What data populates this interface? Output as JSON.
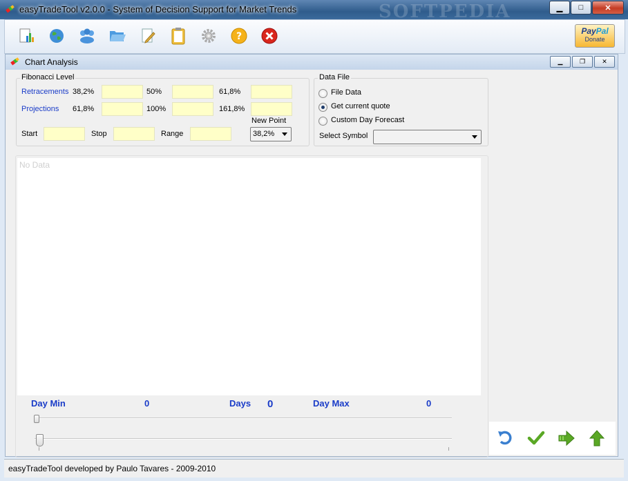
{
  "window": {
    "title": "easyTradeTool v2.0.0 - System of Decision Support for Market Trends",
    "watermark": "SOFTPEDIA"
  },
  "toolbar": {
    "icons": [
      "report-chart-icon",
      "globe-icon",
      "users-group-icon",
      "open-folder-icon",
      "edit-document-icon",
      "clipboard-icon",
      "settings-gear-icon",
      "help-icon",
      "exit-icon"
    ],
    "paypal_brand_1": "Pay",
    "paypal_brand_2": "Pal",
    "paypal_label": "Donate"
  },
  "child": {
    "title": "Chart Analysis"
  },
  "fibonacci": {
    "group_label": "Fibonacci Level",
    "retracements_label": "Retracements",
    "retracement_levels": [
      "38,2%",
      "50%",
      "61,8%"
    ],
    "projections_label": "Projections",
    "projection_levels": [
      "61,8%",
      "100%",
      "161,8%"
    ],
    "start_label": "Start",
    "stop_label": "Stop",
    "range_label": "Range",
    "new_point_label": "New Point",
    "new_point_value": "38,2%"
  },
  "data_file": {
    "group_label": "Data File",
    "options": [
      "File Data",
      "Get current quote",
      "Custom Day Forecast"
    ],
    "selected_option": "Get current quote",
    "select_symbol_label": "Select Symbol",
    "symbol_value": ""
  },
  "chart": {
    "placeholder": "No Data"
  },
  "stats": {
    "day_min_label": "Day Min",
    "day_min_value": "0",
    "days_label": "Days",
    "days_value": "0",
    "day_max_label": "Day Max",
    "day_max_value": "0"
  },
  "actions": [
    "undo-icon",
    "confirm-check-icon",
    "next-arrow-icon",
    "up-arrow-icon"
  ],
  "status": {
    "text": "easyTradeTool  developed by Paulo Tavares - 2009-2010"
  },
  "colors": {
    "label_blue": "#1a3cc8",
    "field_yellow": "#ffffc8"
  }
}
